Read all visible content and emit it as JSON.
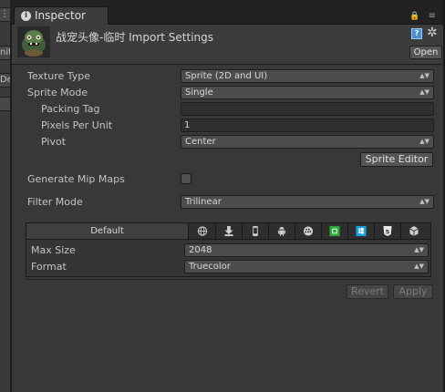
{
  "left_panel": {
    "fragments": [
      "⋮≡",
      "nit",
      "De",
      ""
    ]
  },
  "tab": {
    "label": "Inspector"
  },
  "tab_icons": {
    "lock": "🔒",
    "menu": "≡"
  },
  "header": {
    "title": "战宠头像-临时 Import Settings",
    "open_button": "Open",
    "help_icon": "?",
    "gear_icon": "✲"
  },
  "settings": {
    "texture_type": {
      "label": "Texture Type",
      "value": "Sprite (2D and UI)"
    },
    "sprite_mode": {
      "label": "Sprite Mode",
      "value": "Single"
    },
    "packing_tag": {
      "label": "Packing Tag",
      "value": ""
    },
    "pixels_per_unit": {
      "label": "Pixels Per Unit",
      "value": "1"
    },
    "pivot": {
      "label": "Pivot",
      "value": "Center"
    },
    "sprite_editor_button": "Sprite Editor",
    "generate_mip_maps": {
      "label": "Generate Mip Maps",
      "checked": false
    },
    "filter_mode": {
      "label": "Filter Mode",
      "value": "Trilinear"
    }
  },
  "platforms": {
    "default_tab": "Default",
    "icons": [
      "web-globe-icon",
      "download-standalone-icon",
      "iphone-icon",
      "android-icon",
      "blackberry-icon",
      "windows-store-icon",
      "windows-phone-icon",
      "html5-icon",
      "webgl-cube-icon"
    ],
    "max_size": {
      "label": "Max Size",
      "value": "2048"
    },
    "format": {
      "label": "Format",
      "value": "Truecolor"
    }
  },
  "footer": {
    "revert": "Revert",
    "apply": "Apply"
  },
  "dropdown_arrow": "▲▼"
}
